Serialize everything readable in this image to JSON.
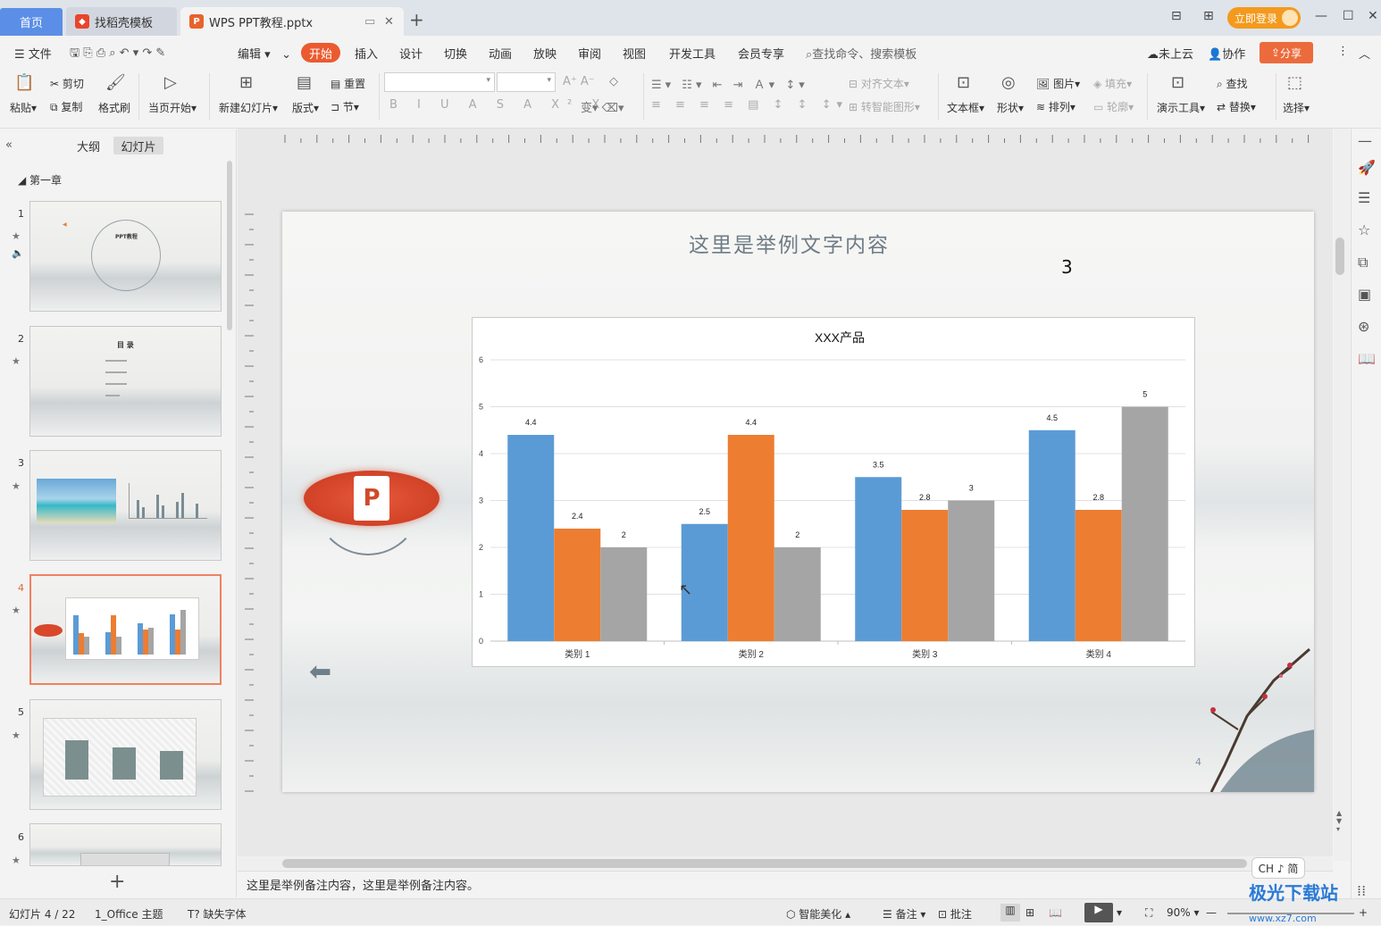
{
  "window": {
    "home_tab": "首页",
    "template_tab": "找稻壳模板",
    "doc_tab": "WPS PPT教程.pptx",
    "login": "立即登录"
  },
  "menu": {
    "file": "文件",
    "edit": "编辑",
    "tabs": [
      "开始",
      "插入",
      "设计",
      "切换",
      "动画",
      "放映",
      "审阅",
      "视图",
      "开发工具",
      "会员专享"
    ],
    "search_placeholder": "查找命令、搜索模板",
    "cloud": "未上云",
    "collab": "协作",
    "share": "分享"
  },
  "ribbon": {
    "paste": "粘贴",
    "cut": "剪切",
    "copy": "复制",
    "format_painter": "格式刷",
    "from_current": "当页开始",
    "new_slide": "新建幻灯片",
    "layout": "版式",
    "reset": "重置",
    "section": "节",
    "align_text": "对齐文本",
    "smart_art": "转智能图形",
    "textbox": "文本框",
    "shape": "形状",
    "picture": "图片",
    "arrange": "排列",
    "fill": "填充",
    "outline": "轮廓",
    "present_tool": "演示工具",
    "find": "查找",
    "replace": "替换",
    "select": "选择"
  },
  "left_panel": {
    "outline_tab": "大纲",
    "slides_tab": "幻灯片",
    "chapter": "第一章",
    "thumb_titles": {
      "t1": "PPT教程",
      "t2": "目 录"
    },
    "slide_numbers": [
      "1",
      "2",
      "3",
      "4",
      "5",
      "6"
    ]
  },
  "slide": {
    "title": "这里是举例文字内容",
    "number_text": "3",
    "page_number": "4",
    "ppt_logo_letter": "P"
  },
  "chart_data": {
    "type": "bar",
    "title": "XXX产品",
    "categories": [
      "类别 1",
      "类别 2",
      "类别 3",
      "类别 4"
    ],
    "series": [
      {
        "values": [
          4.4,
          2.5,
          3.5,
          4.5
        ],
        "color": "#5b9bd5"
      },
      {
        "values": [
          2.4,
          4.4,
          2.8,
          2.8
        ],
        "color": "#ed7d31"
      },
      {
        "values": [
          2,
          2,
          3,
          5
        ],
        "color": "#a5a5a5"
      }
    ],
    "ylim": [
      0,
      6
    ],
    "yticks": [
      "0",
      "1",
      "2",
      "3",
      "4",
      "5",
      "6"
    ],
    "grid": true
  },
  "notes": {
    "text": "这里是举例备注内容，这里是举例备注内容。"
  },
  "status": {
    "slide_counter": "幻灯片 4 / 22",
    "theme": "1_Office 主题",
    "missing_font": "缺失字体",
    "beautify": "智能美化",
    "notes_btn": "备注",
    "comment_btn": "批注",
    "zoom": "90%"
  },
  "ime": {
    "label": "CH ♪ 简"
  },
  "watermark": {
    "text": "极光下载站",
    "url": "www.xz7.com"
  }
}
